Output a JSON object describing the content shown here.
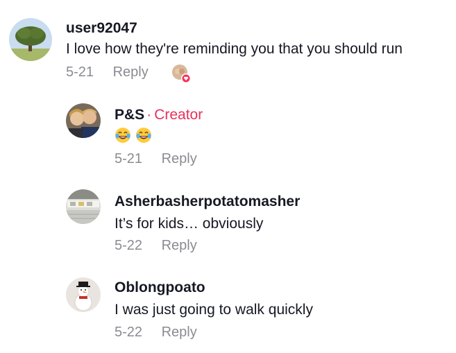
{
  "comments": [
    {
      "username": "user92047",
      "text": "I love how they're reminding you that you should run",
      "date": "5-21",
      "reply_label": "Reply",
      "avatar_icon": "tree-avatar",
      "liked_by_creator_icon": "creator-liked-heart-icon"
    },
    {
      "username": "P&S",
      "creator_separator": "·",
      "creator_label": "Creator",
      "emojis": [
        "laughing-crying-emoji",
        "laughing-crying-emoji"
      ],
      "date": "5-21",
      "reply_label": "Reply",
      "avatar_icon": "couple-photo-avatar"
    },
    {
      "username": "Asherbasherpotatomasher",
      "text": "It’s for kids… obviously",
      "date": "5-22",
      "reply_label": "Reply",
      "avatar_icon": "keyboard-photo-avatar"
    },
    {
      "username": "Oblongpoato",
      "text": "I was just going to walk quickly",
      "date": "5-22",
      "reply_label": "Reply",
      "avatar_icon": "snowman-photo-avatar"
    }
  ],
  "colors": {
    "creator_accent": "#e8305c",
    "meta_gray": "#8a8b91",
    "text_dark": "#161823"
  }
}
